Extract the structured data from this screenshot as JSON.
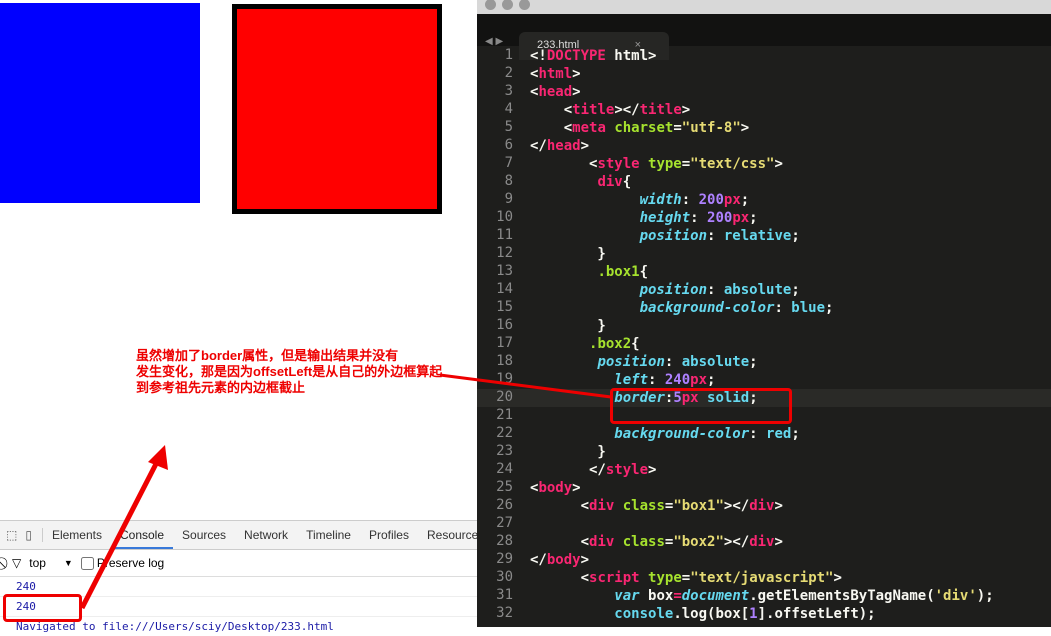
{
  "annotation": {
    "lines": [
      "虽然增加了border属性，但是输出结果并没有",
      "发生变化，那是因为offsetLeft是从自己的外边框算起",
      "到参考祖先元素的内边框截止"
    ]
  },
  "devtools": {
    "tabs": [
      "Elements",
      "Console",
      "Sources",
      "Network",
      "Timeline",
      "Profiles",
      "Resources"
    ],
    "active_tab": "Console",
    "context": "top",
    "preserve_log": "Preserve log",
    "logs": [
      "240",
      "240"
    ],
    "navigated": "Navigated to file:///Users/sciy/Desktop/233.html"
  },
  "editor": {
    "tab_title": "233.html",
    "close": "×",
    "highlight_line": 20,
    "lines": [
      [
        [
          "<!",
          "p"
        ],
        [
          "DOCTYPE",
          "t"
        ],
        [
          " html>",
          "p"
        ]
      ],
      [
        [
          "<",
          "p"
        ],
        [
          "html",
          "t"
        ],
        [
          ">",
          "p"
        ]
      ],
      [
        [
          "<",
          "p"
        ],
        [
          "head",
          "t"
        ],
        [
          ">",
          "p"
        ]
      ],
      [
        [
          "    <",
          "p"
        ],
        [
          "title",
          "t"
        ],
        [
          "></",
          "p"
        ],
        [
          "title",
          "t"
        ],
        [
          ">",
          "p"
        ]
      ],
      [
        [
          "    <",
          "p"
        ],
        [
          "meta ",
          "t"
        ],
        [
          "charset",
          "a"
        ],
        [
          "=",
          "p"
        ],
        [
          "\"utf-8\"",
          "s"
        ],
        [
          ">",
          "p"
        ]
      ],
      [
        [
          "</",
          "p"
        ],
        [
          "head",
          "t"
        ],
        [
          ">",
          "p"
        ]
      ],
      [
        [
          "       <",
          "p"
        ],
        [
          "style ",
          "t"
        ],
        [
          "type",
          "a"
        ],
        [
          "=",
          "p"
        ],
        [
          "\"text/css\"",
          "s"
        ],
        [
          ">",
          "p"
        ]
      ],
      [
        [
          "        ",
          "p"
        ],
        [
          "div",
          "t"
        ],
        [
          "{",
          "p"
        ]
      ],
      [
        [
          "             ",
          "p"
        ],
        [
          "width",
          "k"
        ],
        [
          ": ",
          "p"
        ],
        [
          "200",
          "n"
        ],
        [
          "px",
          "t"
        ],
        [
          ";",
          "p"
        ]
      ],
      [
        [
          "             ",
          "p"
        ],
        [
          "height",
          "k"
        ],
        [
          ": ",
          "p"
        ],
        [
          "200",
          "n"
        ],
        [
          "px",
          "t"
        ],
        [
          ";",
          "p"
        ]
      ],
      [
        [
          "             ",
          "p"
        ],
        [
          "position",
          "k"
        ],
        [
          ": ",
          "p"
        ],
        [
          "relative",
          "c"
        ],
        [
          ";",
          "p"
        ]
      ],
      [
        [
          "        }",
          "p"
        ]
      ],
      [
        [
          "        ",
          "p"
        ],
        [
          ".box1",
          "a"
        ],
        [
          "{",
          "p"
        ]
      ],
      [
        [
          "             ",
          "p"
        ],
        [
          "position",
          "k"
        ],
        [
          ": ",
          "p"
        ],
        [
          "absolute",
          "c"
        ],
        [
          ";",
          "p"
        ]
      ],
      [
        [
          "             ",
          "p"
        ],
        [
          "background-color",
          "k"
        ],
        [
          ": ",
          "p"
        ],
        [
          "blue",
          "c"
        ],
        [
          ";",
          "p"
        ]
      ],
      [
        [
          "        }",
          "p"
        ]
      ],
      [
        [
          "       ",
          "p"
        ],
        [
          ".box2",
          "a"
        ],
        [
          "{",
          "p"
        ]
      ],
      [
        [
          "        ",
          "p"
        ],
        [
          "position",
          "k"
        ],
        [
          ": ",
          "p"
        ],
        [
          "absolute",
          "c"
        ],
        [
          ";",
          "p"
        ]
      ],
      [
        [
          "          ",
          "p"
        ],
        [
          "left",
          "k"
        ],
        [
          ": ",
          "p"
        ],
        [
          "240",
          "n"
        ],
        [
          "px",
          "t"
        ],
        [
          ";",
          "p"
        ]
      ],
      [
        [
          "          ",
          "p"
        ],
        [
          "border",
          "k"
        ],
        [
          ":",
          "p"
        ],
        [
          "5",
          "n"
        ],
        [
          "px",
          "t"
        ],
        [
          " solid",
          "c"
        ],
        [
          ";",
          "p"
        ]
      ],
      [
        [
          "",
          "p"
        ]
      ],
      [
        [
          "          ",
          "p"
        ],
        [
          "background-color",
          "k"
        ],
        [
          ": ",
          "p"
        ],
        [
          "red",
          "c"
        ],
        [
          ";",
          "p"
        ]
      ],
      [
        [
          "        }",
          "p"
        ]
      ],
      [
        [
          "       </",
          "p"
        ],
        [
          "style",
          "t"
        ],
        [
          ">",
          "p"
        ]
      ],
      [
        [
          "<",
          "p"
        ],
        [
          "body",
          "t"
        ],
        [
          ">",
          "p"
        ]
      ],
      [
        [
          "      <",
          "p"
        ],
        [
          "div ",
          "t"
        ],
        [
          "class",
          "a"
        ],
        [
          "=",
          "p"
        ],
        [
          "\"box1\"",
          "s"
        ],
        [
          "></",
          "p"
        ],
        [
          "div",
          "t"
        ],
        [
          ">",
          "p"
        ]
      ],
      [
        [
          "",
          "p"
        ]
      ],
      [
        [
          "      <",
          "p"
        ],
        [
          "div ",
          "t"
        ],
        [
          "class",
          "a"
        ],
        [
          "=",
          "p"
        ],
        [
          "\"box2\"",
          "s"
        ],
        [
          "></",
          "p"
        ],
        [
          "div",
          "t"
        ],
        [
          ">",
          "p"
        ]
      ],
      [
        [
          "</",
          "p"
        ],
        [
          "body",
          "t"
        ],
        [
          ">",
          "p"
        ]
      ],
      [
        [
          "      <",
          "p"
        ],
        [
          "script ",
          "t"
        ],
        [
          "type",
          "a"
        ],
        [
          "=",
          "p"
        ],
        [
          "\"text/javascript\"",
          "s"
        ],
        [
          ">",
          "p"
        ]
      ],
      [
        [
          "          ",
          "p"
        ],
        [
          "var ",
          "k"
        ],
        [
          "box",
          "p"
        ],
        [
          "=",
          "t"
        ],
        [
          "document",
          "k"
        ],
        [
          ".getElementsByTagName(",
          "p"
        ],
        [
          "'div'",
          "s"
        ],
        [
          ");",
          "p"
        ]
      ],
      [
        [
          "          ",
          "p"
        ],
        [
          "console",
          "c"
        ],
        [
          ".log(box[",
          "p"
        ],
        [
          "1",
          "n"
        ],
        [
          "].offsetLeft);",
          "p"
        ]
      ]
    ]
  },
  "colors": {
    "box1": "#0000ff",
    "box2": "#ff0000",
    "annotation": "#ee0000"
  }
}
